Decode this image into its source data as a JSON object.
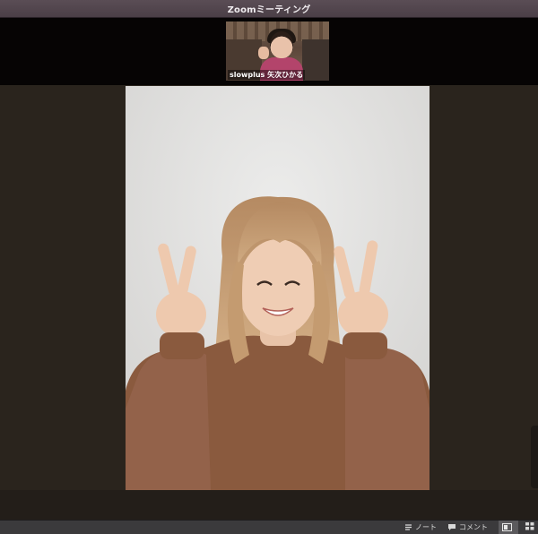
{
  "window": {
    "title": "Zoomミーティング"
  },
  "thumbnail": {
    "participant_name": "slowplus 矢次ひかる"
  },
  "toolbar": {
    "note_label": "ノート",
    "comment_label": "コメント",
    "note_icon": "note-icon",
    "comment_icon": "speech-bubble-icon",
    "panel_icon": "panel-icon",
    "grid_icon": "grid-icon"
  },
  "colors": {
    "background": "#2a241d",
    "titlebar": "#4b3f47",
    "toolbar": "#3b3a3c",
    "sweater": "#8a5a3e"
  }
}
